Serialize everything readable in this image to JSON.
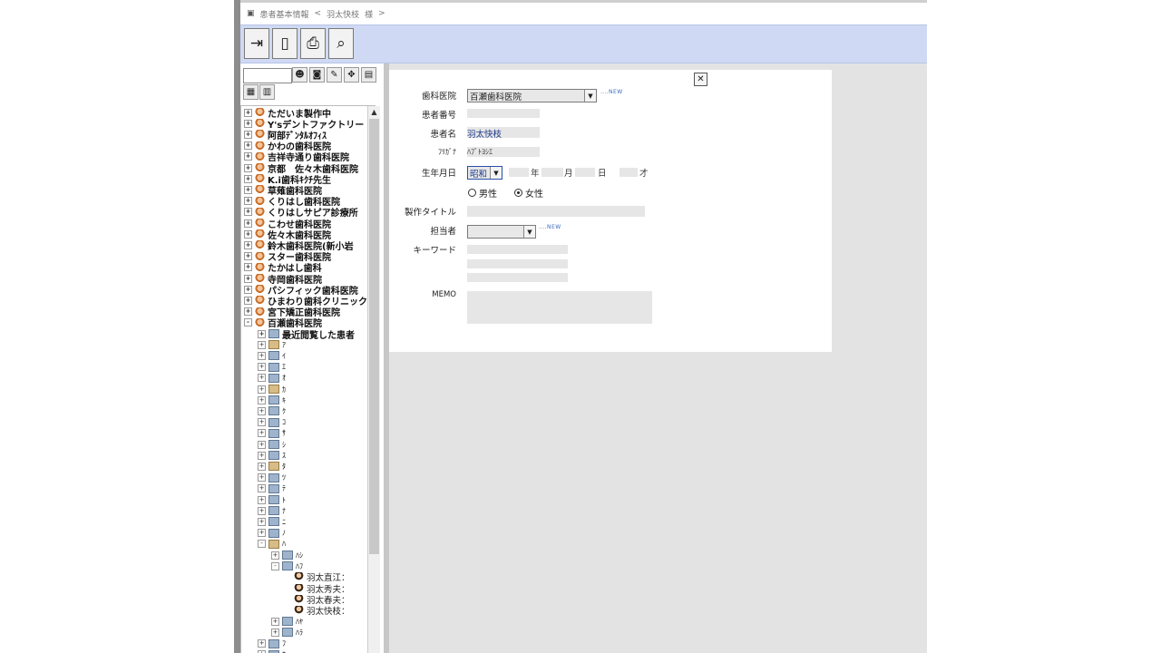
{
  "breadcrumb": {
    "part1": "患者基本情報",
    "sep1": "<",
    "part2": "羽太快枝",
    "part3": "様",
    "sep2": ">"
  },
  "toolbar": {
    "buttons": [
      "exit-icon",
      "document-icon",
      "print-icon",
      "search-icon"
    ]
  },
  "sidebar": {
    "search_value": "",
    "tool_icons": [
      "person-icon",
      "camera-icon",
      "tools-icon",
      "move-icon",
      "list-icon"
    ],
    "view_icons": [
      "grid-icon",
      "detail-icon"
    ],
    "tree": {
      "clinics": [
        "ただいま製作中",
        "Y'sデントファクトリー",
        "阿部ﾃﾞﾝﾀﾙｵﾌｨｽ",
        "かわの歯科医院",
        "吉祥寺通り歯科医院",
        "京都　佐々木歯科医院",
        "K.i歯科ｷｸﾁ先生",
        "草薙歯科医院",
        "くりはし歯科医院",
        "くりはしサピア診療所",
        "こわせ歯科医院",
        "佐々木歯科医院",
        "鈴木歯科医院(新小岩",
        "スター歯科医院",
        "たかはし歯科",
        "寺岡歯科医院",
        "パシフィック歯科医院",
        "ひまわり歯科クリニック",
        "宮下矯正歯科医院",
        "百瀬歯科医院"
      ],
      "recent": "最近閲覧した患者",
      "kana": [
        "ｱ",
        "ｲ",
        "ｴ",
        "ｵ",
        "ｶ",
        "ｷ",
        "ｸ",
        "ｺ",
        "ｻ",
        "ｼ",
        "ｽ",
        "ﾀ",
        "ﾂ",
        "ﾃ",
        "ﾄ",
        "ﾅ",
        "ﾆ",
        "ﾉ",
        "ﾊ"
      ],
      "ha_children": [
        "ﾊｼ",
        "ﾊﾌ"
      ],
      "patients": [
        "羽太直江：",
        "羽太秀夫：",
        "羽太春夫：",
        "羽太快枝："
      ],
      "ha_after": [
        "ﾊﾔ",
        "ﾊﾗ"
      ],
      "tail": [
        "ﾌ",
        "ﾎ"
      ]
    }
  },
  "form": {
    "close_label": "✕",
    "clinic_label": "歯科医院",
    "clinic_value": "百瀬歯科医院",
    "new_label": "NEW",
    "patient_no_label": "患者番号",
    "patient_no_value": "",
    "patient_name_label": "患者名",
    "patient_name_value": "羽太快枝",
    "furigana_label": "ﾌﾘｶﾞﾅ",
    "furigana_value": "ﾊﾌﾞﾄﾖｼｴ",
    "dob_label": "生年月日",
    "era_value": "昭和",
    "year_unit": "年",
    "month_unit": "月",
    "day_unit": "日",
    "age_unit": "才",
    "gender_male": "男性",
    "gender_female": "女性",
    "gender_selected": "female",
    "title_label": "製作タイトル",
    "staff_label": "担当者",
    "staff_value": "",
    "keyword_label": "キーワード",
    "memo_label": "MEMO"
  },
  "colors": {
    "toolbar_bg": "#cfd9f3",
    "content_bg": "#e3e3e3",
    "name_text": "#1d3a8c"
  }
}
